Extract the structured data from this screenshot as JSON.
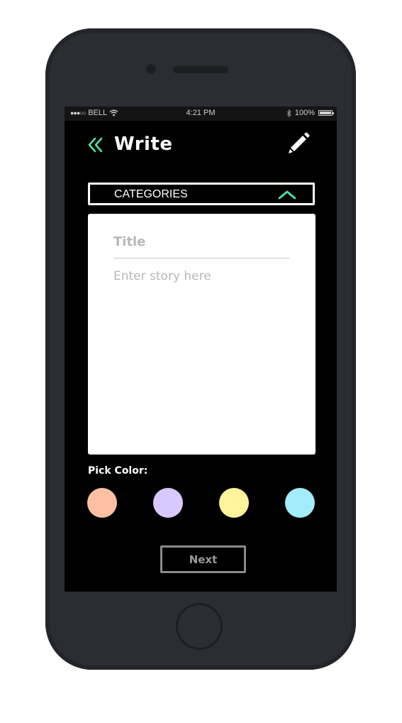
{
  "status_bar": {
    "carrier": "BELL",
    "time": "4:21 PM",
    "battery": "100%"
  },
  "header": {
    "title": "Write",
    "back_icon": "double-chevron-left-icon",
    "edit_icon": "pencil-icon"
  },
  "categories": {
    "label": "CATEGORIES",
    "expand_icon": "chevron-up-icon"
  },
  "story": {
    "title_placeholder": "Title",
    "body_placeholder": "Enter story here",
    "title_value": "",
    "body_value": ""
  },
  "color_picker": {
    "label": "Pick Color:",
    "colors": [
      "#ffbfa3",
      "#d9c8fd",
      "#fff39c",
      "#a3ecfc"
    ]
  },
  "actions": {
    "next_label": "Next"
  },
  "theme": {
    "accent": "#4fe3a6",
    "background": "#000000",
    "phone_body": "#2b2d33"
  }
}
